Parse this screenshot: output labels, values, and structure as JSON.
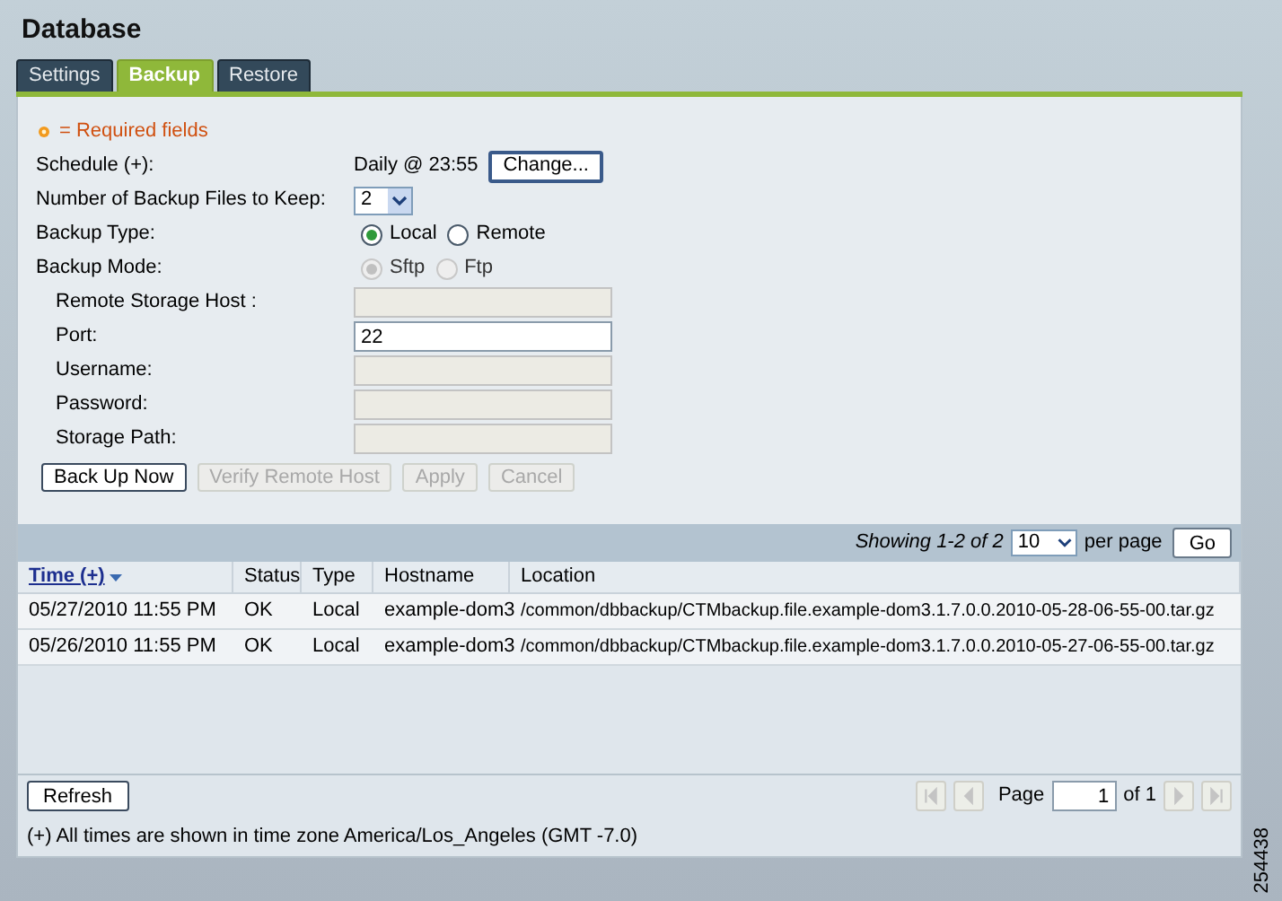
{
  "page": {
    "title": "Database"
  },
  "tabs": [
    {
      "label": "Settings",
      "selected": false
    },
    {
      "label": "Backup",
      "selected": true
    },
    {
      "label": "Restore",
      "selected": false
    }
  ],
  "required_note": "= Required fields",
  "form": {
    "rows": [
      {
        "kind": "schedule",
        "label": "Schedule (+):",
        "value": "Daily @ 23:55",
        "button": "Change..."
      },
      {
        "kind": "select",
        "label": "Number of Backup Files to Keep:",
        "value": "2"
      },
      {
        "kind": "radio",
        "label": "Backup Type:",
        "disabled": false,
        "options": [
          {
            "label": "Local",
            "selected": true
          },
          {
            "label": "Remote",
            "selected": false
          }
        ]
      },
      {
        "kind": "radio",
        "label": "Backup Mode:",
        "disabled": true,
        "options": [
          {
            "label": "Sftp",
            "selected": true
          },
          {
            "label": "Ftp",
            "selected": false
          }
        ]
      },
      {
        "kind": "text",
        "label": "Remote Storage Host :",
        "indented": true,
        "disabled": true
      },
      {
        "kind": "text",
        "label": "Port:",
        "indented": true,
        "disabled": false,
        "value": "22"
      },
      {
        "kind": "text",
        "label": "Username:",
        "indented": true,
        "disabled": true
      },
      {
        "kind": "text",
        "label": "Password:",
        "indented": true,
        "disabled": true
      },
      {
        "kind": "text",
        "label": "Storage Path:",
        "indented": true,
        "disabled": true
      }
    ]
  },
  "actions": [
    {
      "label": "Back Up Now",
      "disabled": false
    },
    {
      "label": "Verify Remote Host",
      "disabled": true
    },
    {
      "label": "Apply",
      "disabled": true
    },
    {
      "label": "Cancel",
      "disabled": true
    }
  ],
  "table": {
    "showing": "Showing 1-2 of 2",
    "per_page": "10",
    "per_page_label": "per page",
    "go": "Go",
    "columns": [
      {
        "label": "Time (+)",
        "sorted": true
      },
      {
        "label": "Status",
        "sorted": false
      },
      {
        "label": "Type",
        "sorted": false
      },
      {
        "label": "Hostname",
        "sorted": false
      },
      {
        "label": "Location",
        "sorted": false
      }
    ],
    "rows": [
      [
        "05/27/2010 11:55 PM",
        "OK",
        "Local",
        "example-dom3",
        "/common/dbbackup/CTMbackup.file.example-dom3.1.7.0.0.2010-05-28-06-55-00.tar.gz"
      ],
      [
        "05/26/2010 11:55 PM",
        "OK",
        "Local",
        "example-dom3",
        "/common/dbbackup/CTMbackup.file.example-dom3.1.7.0.0.2010-05-27-06-55-00.tar.gz"
      ]
    ]
  },
  "footer": {
    "refresh": "Refresh",
    "page_label": "Page",
    "page": "1",
    "of": "of 1",
    "pager_buttons": [
      {
        "kind": "first",
        "disabled": true
      },
      {
        "kind": "prev",
        "disabled": true
      },
      {
        "kind": "next",
        "disabled": true
      },
      {
        "kind": "last",
        "disabled": true
      }
    ],
    "note": "(+) All times are shown in time zone America/Los_Angeles (GMT -7.0)"
  },
  "figure_id": "254438"
}
